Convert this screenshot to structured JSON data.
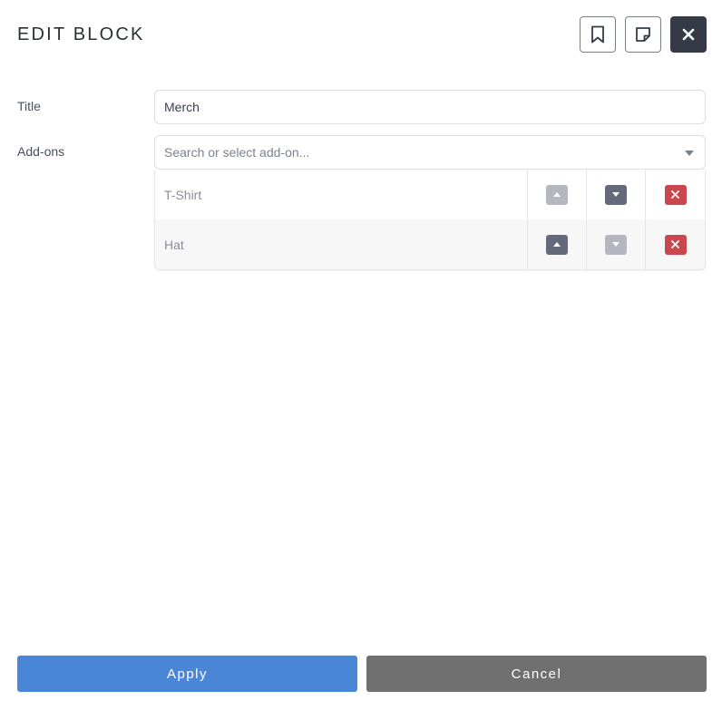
{
  "header": {
    "title": "EDIT BLOCK",
    "bookmark_icon": "bookmark-icon",
    "note_icon": "sticky-note-icon",
    "close_icon": "close-icon"
  },
  "form": {
    "title_label": "Title",
    "title_value": "Merch",
    "addons_label": "Add-ons",
    "addons_placeholder": "Search or select add-on..."
  },
  "addons": [
    {
      "name": "T-Shirt",
      "move_up_enabled": false,
      "move_down_enabled": true
    },
    {
      "name": "Hat",
      "move_up_enabled": true,
      "move_down_enabled": false
    }
  ],
  "footer": {
    "apply_label": "Apply",
    "cancel_label": "Cancel"
  },
  "colors": {
    "apply": "#4a86d8",
    "cancel": "#707070",
    "close_button": "#353a47",
    "remove": "#c9474d",
    "move_enabled": "#646a7c",
    "move_disabled": "#b4b7c0"
  }
}
